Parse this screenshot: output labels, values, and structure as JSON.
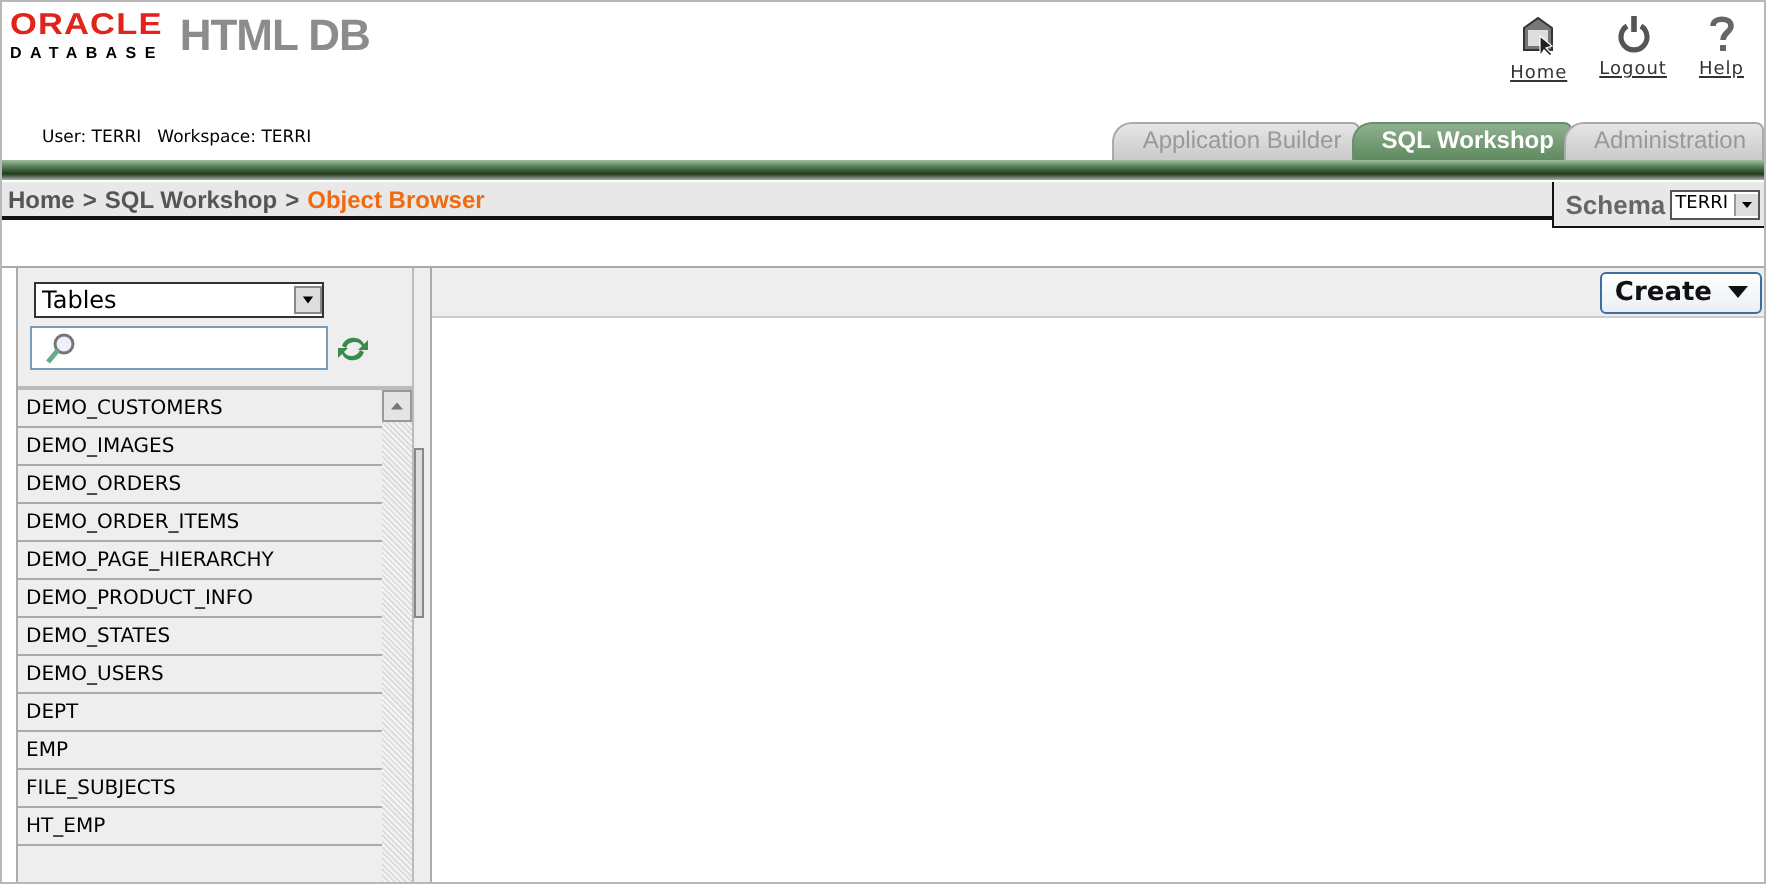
{
  "logo": {
    "brand": "ORACLE",
    "product_line": "DATABASE",
    "product": "HTML DB"
  },
  "header_links": [
    {
      "label": "Home",
      "kind": "home"
    },
    {
      "label": "Logout",
      "kind": "logout"
    },
    {
      "label": "Help",
      "kind": "help"
    }
  ],
  "user_info": {
    "user": "User: TERRI",
    "workspace": "Workspace: TERRI"
  },
  "tabs": [
    {
      "label": "Application Builder",
      "selected": false
    },
    {
      "label": "SQL Workshop",
      "selected": true
    },
    {
      "label": "Administration",
      "selected": false
    }
  ],
  "breadcrumb": {
    "separator": ">",
    "items": [
      {
        "label": "Home",
        "current": false
      },
      {
        "label": "SQL Workshop",
        "current": false
      },
      {
        "label": "Object Browser",
        "current": true
      }
    ]
  },
  "schema": {
    "label": "Schema",
    "value": "TERRI"
  },
  "object_type": {
    "value": "Tables"
  },
  "objects": [
    "DEMO_CUSTOMERS",
    "DEMO_IMAGES",
    "DEMO_ORDERS",
    "DEMO_ORDER_ITEMS",
    "DEMO_PAGE_HIERARCHY",
    "DEMO_PRODUCT_INFO",
    "DEMO_STATES",
    "DEMO_USERS",
    "DEPT",
    "EMP",
    "FILE_SUBJECTS",
    "HT_EMP"
  ],
  "create_button": {
    "label": "Create"
  }
}
